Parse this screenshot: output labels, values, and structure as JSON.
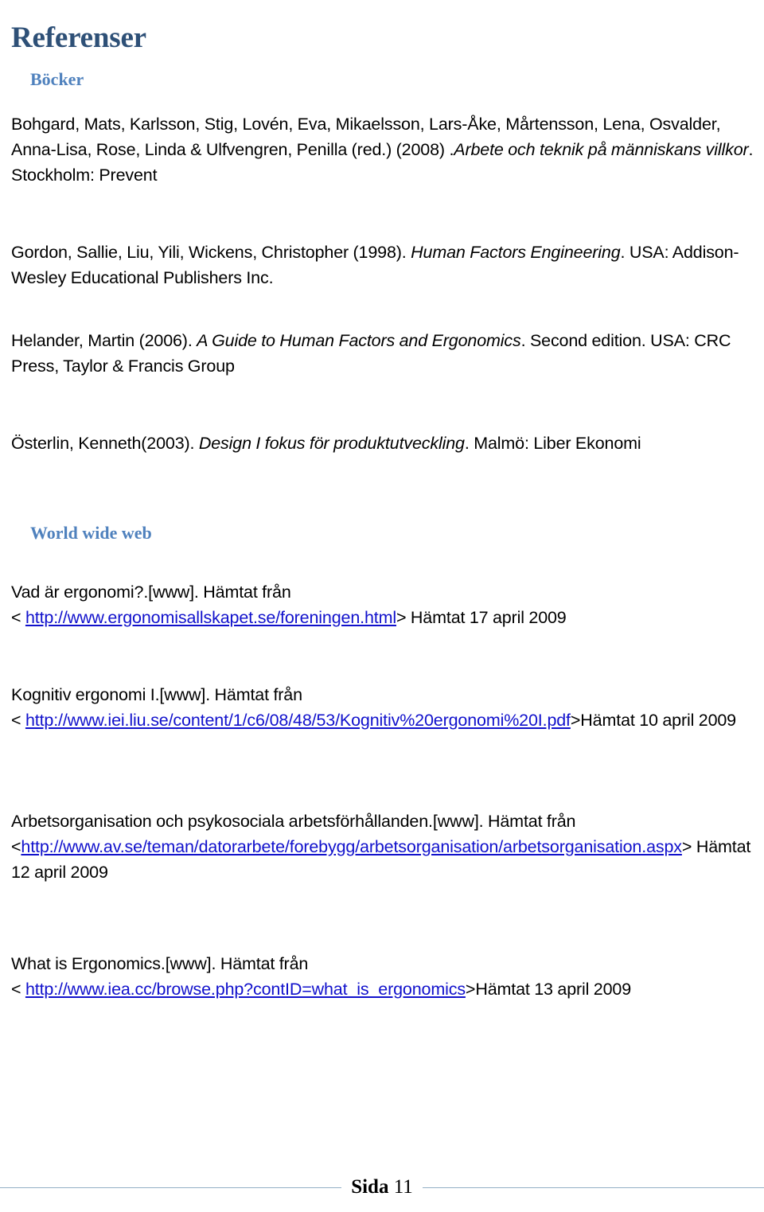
{
  "document": {
    "title": "Referenser",
    "title_color": "#2E5077",
    "heading_color": "#4F81BD",
    "link_color": "#1111CC"
  },
  "sections": {
    "books": {
      "heading": "Böcker",
      "entries": [
        {
          "pre": "Bohgard, Mats, Karlsson, Stig, Lovén, Eva, Mikaelsson, Lars-Åke, Mårtensson, Lena, Osvalder, Anna-Lisa, Rose, Linda & Ulfvengren, Penilla (red.) (2008) .",
          "italic": "Arbete och teknik på människans villkor",
          "post": ". Stockholm: Prevent"
        },
        {
          "pre": "Gordon, Sallie, Liu, Yili, Wickens, Christopher (1998). ",
          "italic": "Human Factors Engineering",
          "post": ". USA: Addison-Wesley Educational Publishers Inc."
        },
        {
          "pre": "Helander, Martin (2006). ",
          "italic": "A Guide to Human Factors and Ergonomics",
          "post": ". Second edition. USA: CRC Press, Taylor & Francis Group"
        },
        {
          "pre": "Österlin, Kenneth(2003). ",
          "italic": "Design I fokus för produktutveckling",
          "post": ". Malmö: Liber Ekonomi"
        }
      ]
    },
    "web": {
      "heading": "World wide web",
      "entries": [
        {
          "source": "Vad är ergonomi?.[www]. Hämtat från",
          "bracket_open": "< ",
          "url": "http://www.ergonomisallskapet.se/foreningen.html",
          "bracket_close": "> ",
          "retrieved": "Hämtat 17 april 2009"
        },
        {
          "source": "Kognitiv ergonomi I.[www]. Hämtat från",
          "bracket_open": "< ",
          "url": "http://www.iei.liu.se/content/1/c6/08/48/53/Kognitiv%20ergonomi%20I.pdf",
          "bracket_close": ">",
          "retrieved": "Hämtat 10 april 2009"
        },
        {
          "source": "Arbetsorganisation och psykosociala arbetsförhållanden.[www]. Hämtat från",
          "bracket_open": "<",
          "url": "http://www.av.se/teman/datorarbete/forebygg/arbetsorganisation/arbetsorganisation.aspx",
          "bracket_close": "> ",
          "retrieved": "Hämtat 12 april 2009"
        },
        {
          "source": "What is Ergonomics.[www]. Hämtat från",
          "bracket_open": "< ",
          "url": "http://www.iea.cc/browse.php?contID=what_is_ergonomics",
          "bracket_close": ">",
          "retrieved": "Hämtat 13 april 2009"
        }
      ]
    }
  },
  "footer": {
    "label": "Sida",
    "page_number": "11"
  }
}
